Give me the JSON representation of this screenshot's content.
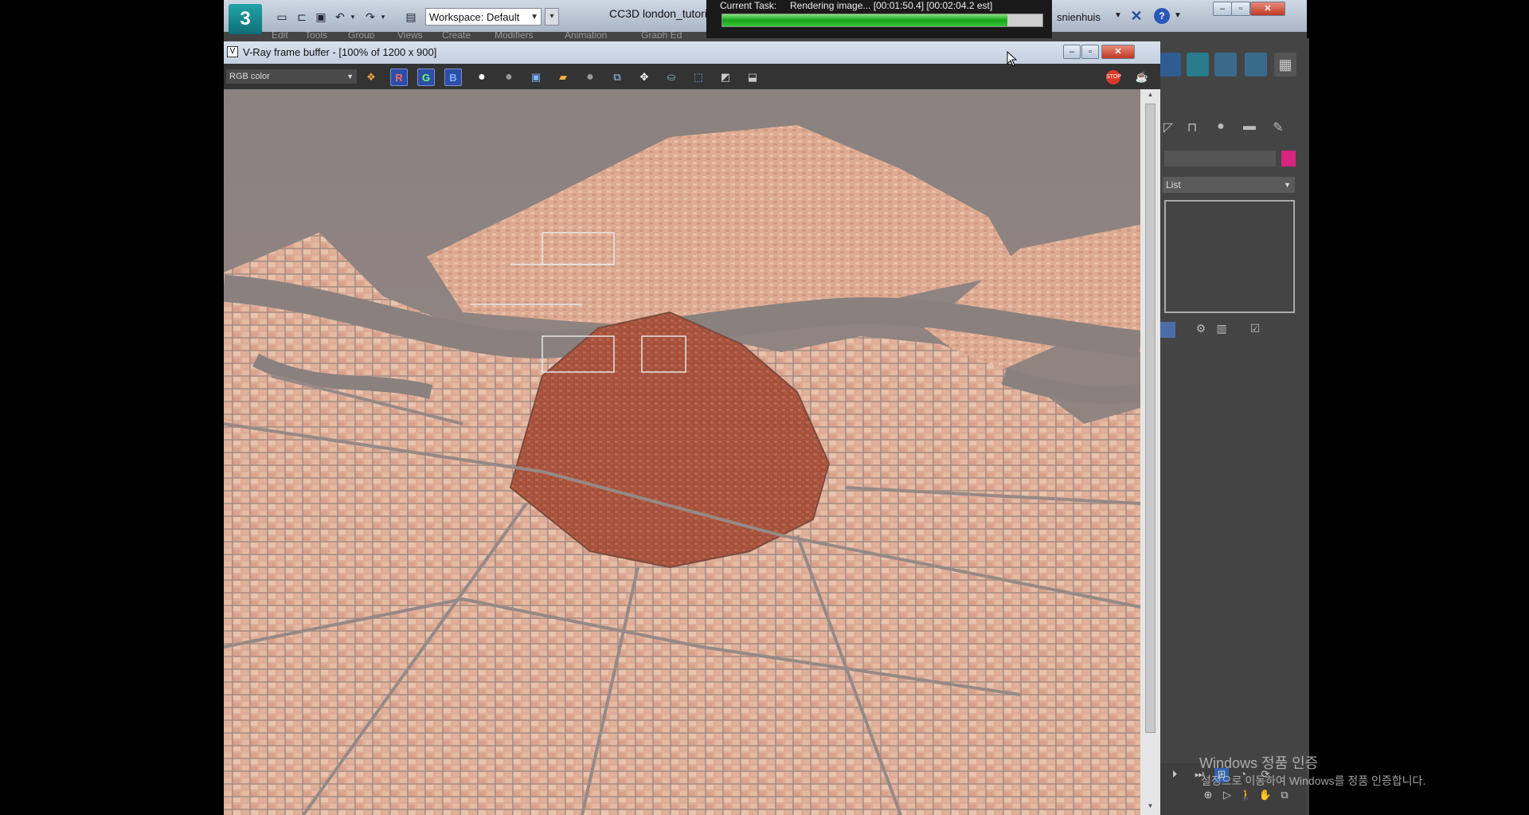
{
  "app": {
    "logo_text": "3",
    "workspace_label": "Workspace: Default",
    "document_title": "CC3D london_tutori",
    "menu": [
      "Edit",
      "Tools",
      "Group",
      "Views",
      "Create",
      "Modifiers",
      "Animation",
      "Graph Ed"
    ],
    "user_name": "snienhuis",
    "quick_access_icons": [
      "new-icon",
      "open-icon",
      "save-icon",
      "undo-icon",
      "redo-icon",
      "project-icon"
    ]
  },
  "render_progress": {
    "label": "Current Task:",
    "task": "Rendering image... [00:01:50.4] [00:02:04.2 est]",
    "progress": 0.89,
    "color": "#1aa31a"
  },
  "vfb": {
    "title": "V-Ray frame buffer - [100% of 1200 x 900]",
    "channel": "RGB color",
    "r_label": "R",
    "g_label": "G",
    "b_label": "B",
    "stop_label": "STOP"
  },
  "command_panel": {
    "modifier_list_label": "List",
    "swatch_color": "#d6247f"
  },
  "watermark": {
    "line1": "Windows 정품 인증",
    "line2": "설정으로 이동하여 Windows를 정품 인증합니다."
  }
}
